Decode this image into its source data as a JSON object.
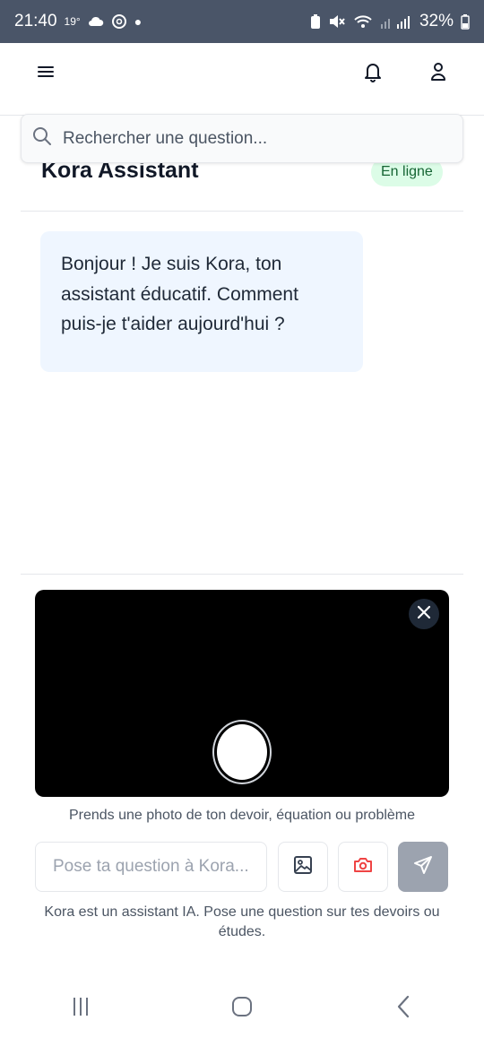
{
  "status_bar": {
    "time": "21:40",
    "temperature": "19°",
    "battery": "32%",
    "icons": [
      "cloud-icon",
      "threads-icon",
      "battery-saver-icon",
      "mute-icon",
      "wifi-icon",
      "signal-icon",
      "battery-icon"
    ]
  },
  "header": {
    "icons": [
      "menu-icon",
      "bell-icon",
      "user-icon"
    ]
  },
  "search": {
    "placeholder": "Rechercher une question..."
  },
  "chat": {
    "title": "Kora Assistant",
    "status": "En ligne",
    "messages": [
      {
        "from": "assistant",
        "text": "Bonjour ! Je suis Kora, ton assistant éducatif. Comment puis-je t'aider aujourd'hui ?"
      }
    ]
  },
  "camera": {
    "hint": "Prends une photo de ton devoir, équation ou problème"
  },
  "composer": {
    "placeholder": "Pose ta question à Kora...",
    "icons": [
      "image-icon",
      "camera-icon",
      "send-icon"
    ],
    "accent_color": "#ef4444",
    "send_color": "#9ca3af"
  },
  "disclaimer": "Kora est un assistant IA. Pose une question sur tes devoirs ou études.",
  "system_nav": {
    "icons": [
      "recent-apps-icon",
      "home-icon",
      "back-icon"
    ]
  }
}
